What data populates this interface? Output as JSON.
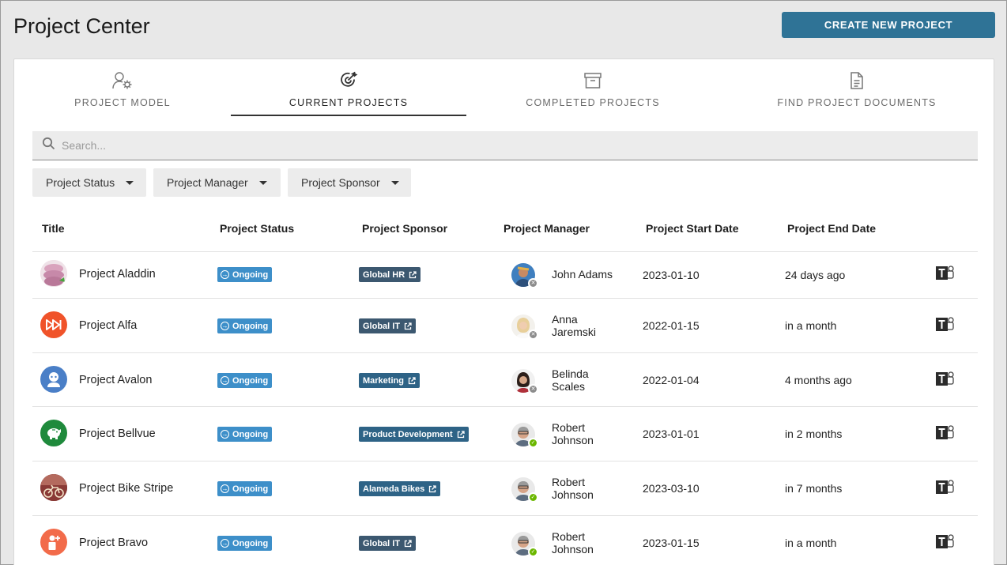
{
  "header": {
    "title": "Project Center",
    "create_button": "CREATE NEW PROJECT"
  },
  "tabs": [
    {
      "label": "PROJECT MODEL",
      "icon": "user-gear-icon",
      "active": false
    },
    {
      "label": "CURRENT PROJECTS",
      "icon": "target-icon",
      "active": true
    },
    {
      "label": "COMPLETED PROJECTS",
      "icon": "archive-box-icon",
      "active": false
    },
    {
      "label": "FIND PROJECT DOCUMENTS",
      "icon": "document-icon",
      "active": false
    }
  ],
  "search": {
    "placeholder": "Search..."
  },
  "filters": [
    "Project Status",
    "Project Manager",
    "Project Sponsor"
  ],
  "columns": [
    "Title",
    "Project Status",
    "Project Sponsor",
    "Project Manager",
    "Project Start Date",
    "Project End Date"
  ],
  "rows": [
    {
      "title": "Project Aladdin",
      "status": "Ongoing",
      "sponsor": "Global HR",
      "manager_line1": "John Adams",
      "manager_line2": "",
      "presence": "offline",
      "start": "2023-01-10",
      "end": "24 days ago"
    },
    {
      "title": "Project Alfa",
      "status": "Ongoing",
      "sponsor": "Global IT",
      "manager_line1": "Anna",
      "manager_line2": "Jaremski",
      "presence": "offline",
      "start": "2022-01-15",
      "end": "in a month"
    },
    {
      "title": "Project Avalon",
      "status": "Ongoing",
      "sponsor": "Marketing",
      "manager_line1": "Belinda",
      "manager_line2": "Scales",
      "presence": "offline",
      "start": "2022-01-04",
      "end": "4 months ago"
    },
    {
      "title": "Project Bellvue",
      "status": "Ongoing",
      "sponsor": "Product Development",
      "manager_line1": "Robert",
      "manager_line2": "Johnson",
      "presence": "available",
      "start": "2023-01-01",
      "end": "in 2 months"
    },
    {
      "title": "Project Bike Stripe",
      "status": "Ongoing",
      "sponsor": "Alameda Bikes",
      "manager_line1": "Robert",
      "manager_line2": "Johnson",
      "presence": "available",
      "start": "2023-03-10",
      "end": "in 7 months"
    },
    {
      "title": "Project Bravo",
      "status": "Ongoing",
      "sponsor": "Global IT",
      "manager_line1": "Robert",
      "manager_line2": "Johnson",
      "presence": "available",
      "start": "2023-01-15",
      "end": "in a month"
    }
  ],
  "colors": {
    "accent": "#2f7396",
    "status_badge": "#3d8fc9",
    "sponsor_badge": "#3c5870"
  }
}
